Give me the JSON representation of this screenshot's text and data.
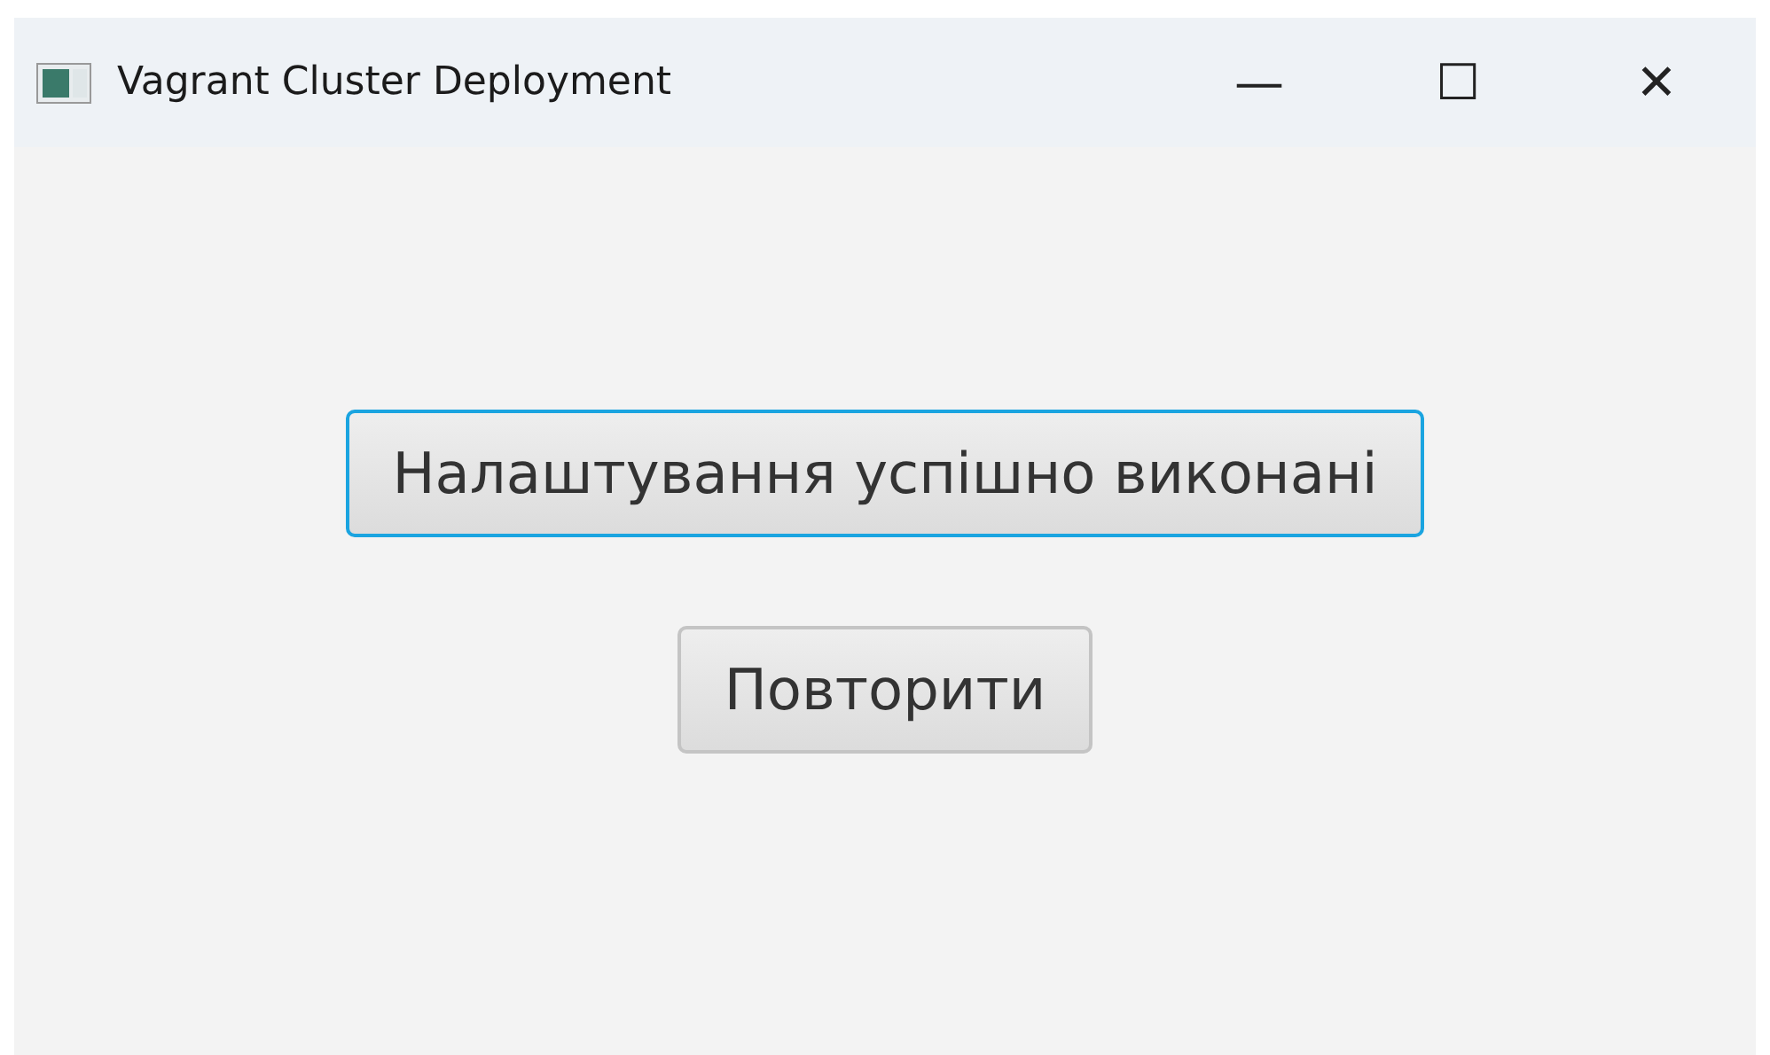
{
  "window": {
    "title": "Vagrant Cluster Deployment",
    "controls": [
      "—",
      "☐",
      "✕"
    ]
  },
  "buttons": [
    {
      "label": "Налаштування успішно виконані",
      "focused": true
    },
    {
      "label": "Повторити",
      "focused": false
    }
  ]
}
